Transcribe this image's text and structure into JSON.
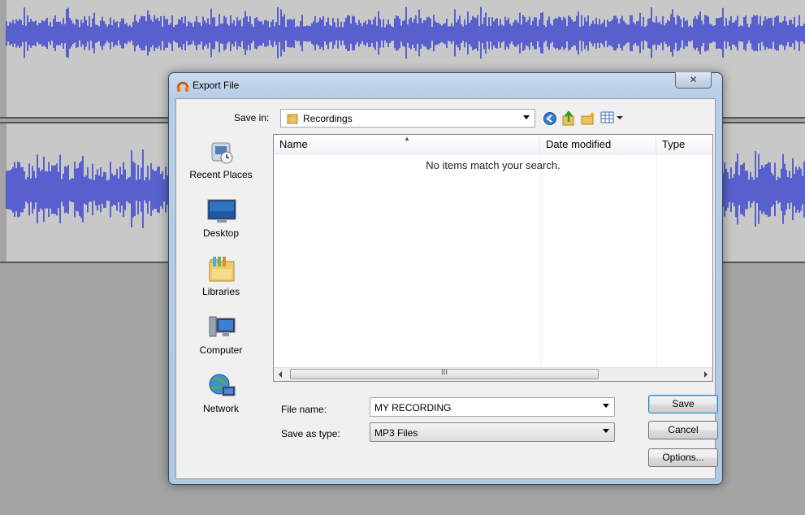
{
  "dialog": {
    "title": "Export File",
    "close_glyph": "✕"
  },
  "savein": {
    "label": "Save in:",
    "value": "Recordings"
  },
  "places": [
    {
      "label": "Recent Places",
      "icon": "recent-places-icon"
    },
    {
      "label": "Desktop",
      "icon": "desktop-icon"
    },
    {
      "label": "Libraries",
      "icon": "libraries-icon"
    },
    {
      "label": "Computer",
      "icon": "computer-icon"
    },
    {
      "label": "Network",
      "icon": "network-icon"
    }
  ],
  "list": {
    "columns": [
      "Name",
      "Date modified",
      "Type"
    ],
    "empty_message": "No items match your search.",
    "scroll_thumb_glyph": "III"
  },
  "filename": {
    "label": "File name:",
    "value": "MY RECORDING"
  },
  "savetype": {
    "label": "Save as type:",
    "value": "MP3 Files"
  },
  "buttons": {
    "save": "Save",
    "cancel": "Cancel",
    "options": "Options..."
  },
  "colors": {
    "waveform": "#3b46cf",
    "track_bg": "#c8c8c8",
    "app_bg": "#a4a4a4"
  }
}
